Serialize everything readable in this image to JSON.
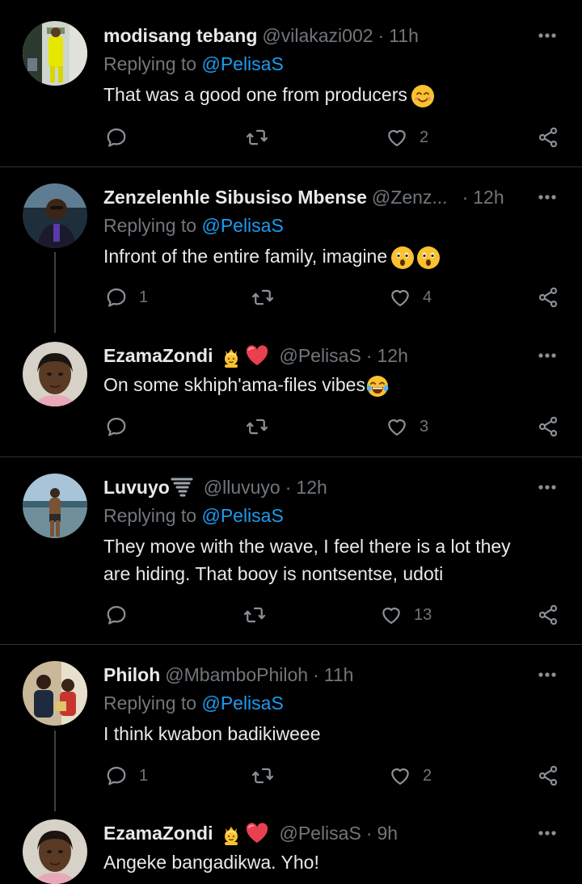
{
  "colors": {
    "background": "#000000",
    "text": "#e7e9ea",
    "muted": "#71767b",
    "link": "#1d9bf0",
    "divider": "#2f3336"
  },
  "tweets": [
    {
      "name": "modisang tebang",
      "handle": "@vilakazi002",
      "separator": "·",
      "time": "11h",
      "replying_prefix": "Replying to",
      "replying_to": "@PelisaS",
      "text": "That was a good one from producers",
      "text_emoji": "smiling-face-icon",
      "counts": {
        "reply": "",
        "retweet": "",
        "like": "2"
      }
    },
    {
      "name": "Zenzelenhle Sibusiso Mbense",
      "handle": "@Zenz...",
      "separator": "·",
      "time": "12h",
      "replying_prefix": "Replying to",
      "replying_to": "@PelisaS",
      "text": "Infront of the entire family, imagine",
      "text_emoji": "astonished-face-icon",
      "counts": {
        "reply": "1",
        "retweet": "",
        "like": "4"
      }
    },
    {
      "name": "EzamaZondi",
      "name_emojis": [
        "person-with-crown-icon",
        "red-heart-icon"
      ],
      "handle": "@PelisaS",
      "separator": "·",
      "time": "12h",
      "text": "On some skhiph'ama-files vibes",
      "text_emoji": "tears-of-joy-icon",
      "counts": {
        "reply": "",
        "retweet": "",
        "like": "3"
      }
    },
    {
      "name": "Luvuyo",
      "name_emojis": [
        "tornado-icon"
      ],
      "handle": "@lluvuyo",
      "separator": "·",
      "time": "12h",
      "replying_prefix": "Replying to",
      "replying_to": "@PelisaS",
      "text": "They move with the wave, I feel there is a lot they are hiding. That booy is nontsentse, udoti",
      "counts": {
        "reply": "",
        "retweet": "",
        "like": "13"
      }
    },
    {
      "name": "Philoh",
      "handle": "@MbamboPhiloh",
      "separator": "·",
      "time": "11h",
      "replying_prefix": "Replying to",
      "replying_to": "@PelisaS",
      "text": "I think kwabon badikiweee",
      "counts": {
        "reply": "1",
        "retweet": "",
        "like": "2"
      }
    },
    {
      "name": "EzamaZondi",
      "name_emojis": [
        "person-with-crown-icon",
        "red-heart-icon"
      ],
      "handle": "@PelisaS",
      "separator": "·",
      "time": "9h",
      "text": "Angeke bangadikwa. Yho!"
    }
  ]
}
